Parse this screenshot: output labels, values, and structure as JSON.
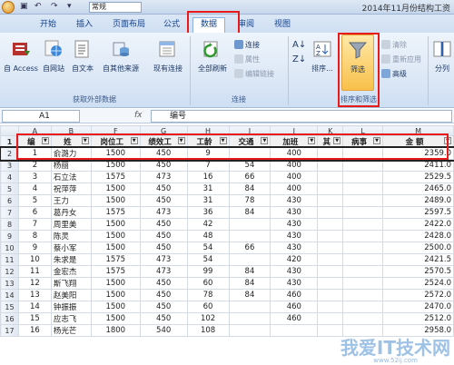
{
  "window": {
    "title": "2014年11月份结构工资",
    "style_combo": "常规"
  },
  "tabs": [
    {
      "label": "开始"
    },
    {
      "label": "插入"
    },
    {
      "label": "页面布局"
    },
    {
      "label": "公式"
    },
    {
      "label": "数据"
    },
    {
      "label": "审阅"
    },
    {
      "label": "视图"
    }
  ],
  "ribbon": {
    "ext_data": {
      "label": "获取外部数据",
      "access": "自 Access",
      "web": "自网站",
      "text": "自文本",
      "other": "自其他来源",
      "existing": "现有连接"
    },
    "connections": {
      "label": "连接",
      "refresh_all": "全部刷新",
      "connections": "连接",
      "properties": "属性",
      "edit_links": "编辑链接"
    },
    "sort_filter": {
      "label": "排序和筛选",
      "sort": "排序...",
      "filter": "筛选",
      "clear": "清除",
      "reapply": "重新应用",
      "advanced": "高级"
    },
    "data_tools": {
      "split": "分列"
    }
  },
  "formula_bar": {
    "name_box": "A1",
    "fx": "fx",
    "content": "编号"
  },
  "columns": [
    "A",
    "B",
    "F",
    "G",
    "H",
    "I",
    "J",
    "K",
    "L",
    "M"
  ],
  "header_row": [
    "编",
    "姓",
    "岗位工",
    "绩效工",
    "工龄",
    "交通",
    "加班",
    "其",
    "病事",
    "金 额"
  ],
  "rows": [
    {
      "n": "2",
      "cells": [
        "1",
        "俞潞力",
        "1500",
        "450",
        "9",
        "",
        "400",
        "",
        "",
        "2359.0"
      ]
    },
    {
      "n": "3",
      "cells": [
        "2",
        "杨丽",
        "1500",
        "450",
        "7",
        "54",
        "400",
        "",
        "",
        "2411.0"
      ]
    },
    {
      "n": "4",
      "cells": [
        "3",
        "石立法",
        "1575",
        "473",
        "16",
        "66",
        "400",
        "",
        "",
        "2529.5"
      ]
    },
    {
      "n": "5",
      "cells": [
        "4",
        "祝萍萍",
        "1500",
        "450",
        "31",
        "84",
        "400",
        "",
        "",
        "2465.0"
      ]
    },
    {
      "n": "6",
      "cells": [
        "5",
        "王力",
        "1500",
        "450",
        "31",
        "78",
        "430",
        "",
        "",
        "2489.0"
      ]
    },
    {
      "n": "7",
      "cells": [
        "6",
        "葛丹女",
        "1575",
        "473",
        "36",
        "84",
        "430",
        "",
        "",
        "2597.5"
      ]
    },
    {
      "n": "8",
      "cells": [
        "7",
        "周里美",
        "1500",
        "450",
        "42",
        "",
        "430",
        "",
        "",
        "2422.0"
      ]
    },
    {
      "n": "9",
      "cells": [
        "8",
        "陈灵",
        "1500",
        "450",
        "48",
        "",
        "430",
        "",
        "",
        "2428.0"
      ]
    },
    {
      "n": "10",
      "cells": [
        "9",
        "蔡小军",
        "1500",
        "450",
        "54",
        "66",
        "430",
        "",
        "",
        "2500.0"
      ]
    },
    {
      "n": "11",
      "cells": [
        "10",
        "朱求是",
        "1575",
        "473",
        "54",
        "",
        "420",
        "",
        "",
        "2421.5"
      ]
    },
    {
      "n": "12",
      "cells": [
        "11",
        "金宏杰",
        "1575",
        "473",
        "99",
        "84",
        "430",
        "",
        "",
        "2570.5"
      ]
    },
    {
      "n": "13",
      "cells": [
        "12",
        "斯飞翔",
        "1500",
        "450",
        "60",
        "84",
        "430",
        "",
        "",
        "2524.0"
      ]
    },
    {
      "n": "14",
      "cells": [
        "13",
        "赵美阳",
        "1500",
        "450",
        "78",
        "84",
        "460",
        "",
        "",
        "2572.0"
      ]
    },
    {
      "n": "15",
      "cells": [
        "14",
        "钟振振",
        "1500",
        "450",
        "60",
        "",
        "460",
        "",
        "",
        "2470.0"
      ]
    },
    {
      "n": "16",
      "cells": [
        "15",
        "应志飞",
        "1500",
        "450",
        "102",
        "",
        "460",
        "",
        "",
        "2512.0"
      ]
    },
    {
      "n": "17",
      "cells": [
        "16",
        "杨光芒",
        "1800",
        "540",
        "108",
        "",
        "",
        "",
        "",
        "2958.0"
      ]
    }
  ],
  "watermark": {
    "text": "我爱IT技术网",
    "url": "www.52ij.com"
  }
}
